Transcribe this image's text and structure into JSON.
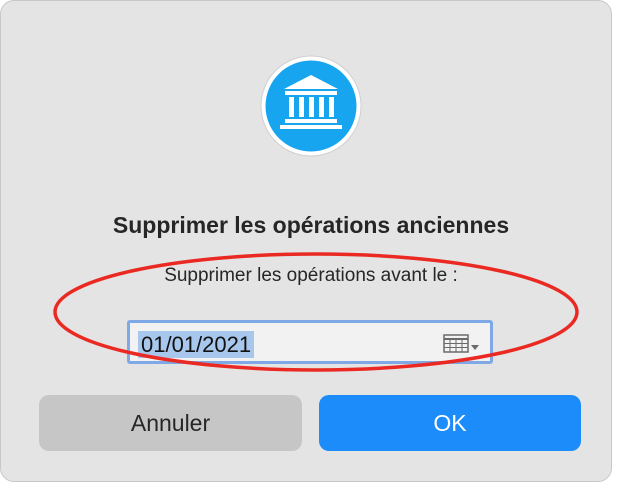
{
  "dialog": {
    "title": "Supprimer les opérations anciennes",
    "prompt": "Supprimer les opérations avant le :",
    "app_icon": "bank-icon",
    "date_field": {
      "value": "01/01/2021",
      "icon": "calendar-grid-icon"
    },
    "buttons": {
      "cancel_label": "Annuler",
      "ok_label": "OK"
    }
  },
  "colors": {
    "dialog_background": "#e4e4e4",
    "accent": "#1b8cfa",
    "icon_blue": "#18a5f0",
    "selection": "#a8c7ec",
    "focus_ring": "#7fa9e6",
    "annotation_red": "#ea2a22"
  }
}
